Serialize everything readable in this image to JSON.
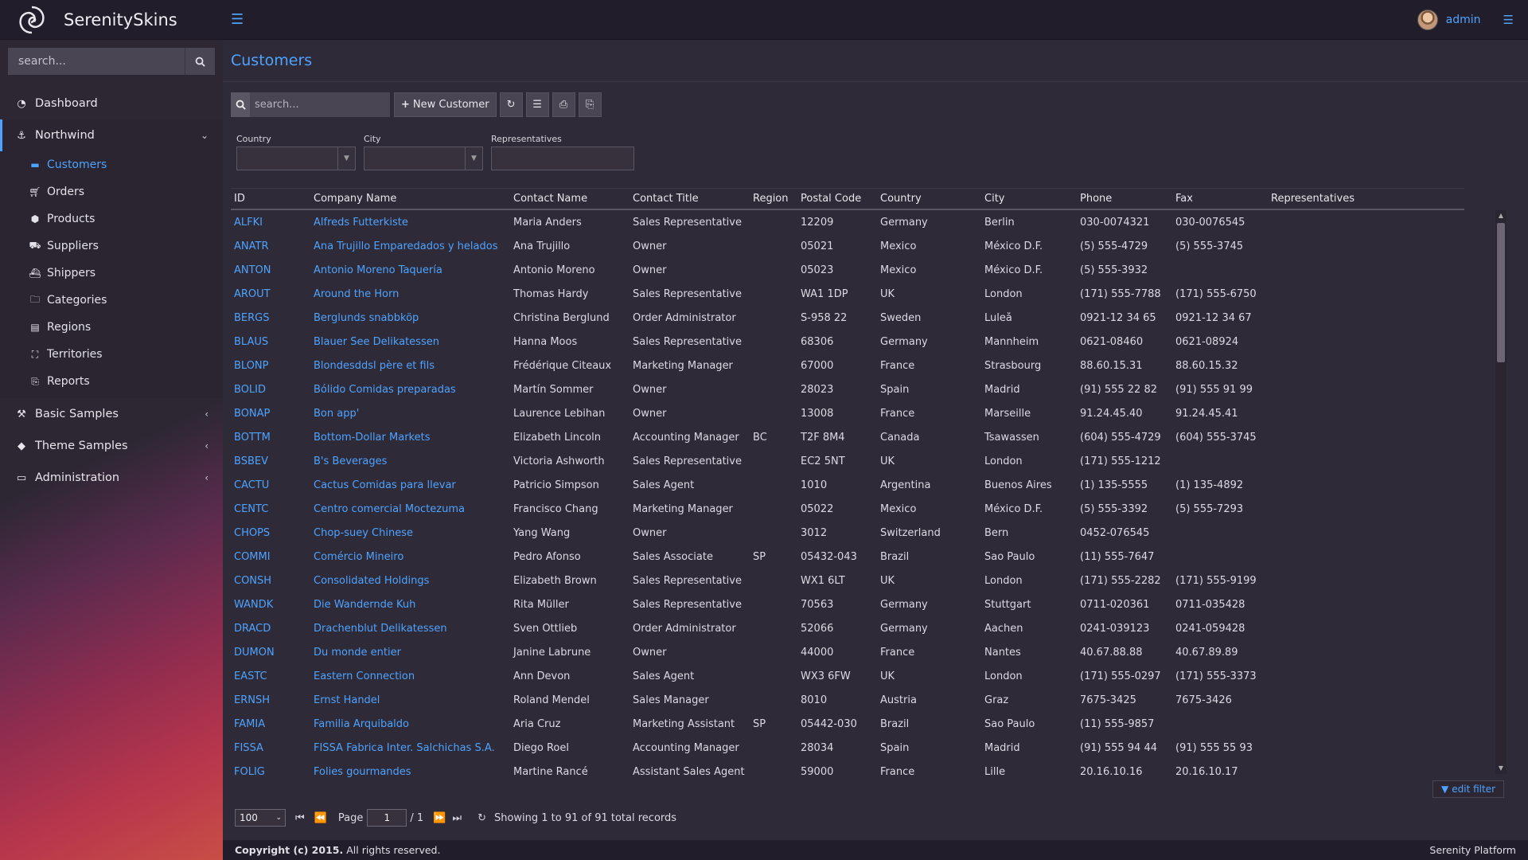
{
  "app": {
    "title": "SerenitySkins",
    "user": "admin"
  },
  "sidebar": {
    "search_placeholder": "search...",
    "dashboard": "Dashboard",
    "northwind": "Northwind",
    "northwind_items": [
      {
        "label": "Customers"
      },
      {
        "label": "Orders"
      },
      {
        "label": "Products"
      },
      {
        "label": "Suppliers"
      },
      {
        "label": "Shippers"
      },
      {
        "label": "Categories"
      },
      {
        "label": "Regions"
      },
      {
        "label": "Territories"
      },
      {
        "label": "Reports"
      }
    ],
    "basic_samples": "Basic Samples",
    "theme_samples": "Theme Samples",
    "administration": "Administration"
  },
  "page": {
    "title": "Customers"
  },
  "toolbar": {
    "search_placeholder": "search...",
    "new_customer": "New Customer"
  },
  "filters": {
    "country": "Country",
    "city": "City",
    "representatives": "Representatives"
  },
  "columns": [
    "ID",
    "Company Name",
    "Contact Name",
    "Contact Title",
    "Region",
    "Postal Code",
    "Country",
    "City",
    "Phone",
    "Fax",
    "Representatives"
  ],
  "rows": [
    [
      "ALFKI",
      "Alfreds Futterkiste",
      "Maria Anders",
      "Sales Representative",
      "",
      "12209",
      "Germany",
      "Berlin",
      "030-0074321",
      "030-0076545",
      ""
    ],
    [
      "ANATR",
      "Ana Trujillo Emparedados y helados",
      "Ana Trujillo",
      "Owner",
      "",
      "05021",
      "Mexico",
      "México D.F.",
      "(5) 555-4729",
      "(5) 555-3745",
      ""
    ],
    [
      "ANTON",
      "Antonio Moreno Taquería",
      "Antonio Moreno",
      "Owner",
      "",
      "05023",
      "Mexico",
      "México D.F.",
      "(5) 555-3932",
      "",
      ""
    ],
    [
      "AROUT",
      "Around the Horn",
      "Thomas Hardy",
      "Sales Representative",
      "",
      "WA1 1DP",
      "UK",
      "London",
      "(171) 555-7788",
      "(171) 555-6750",
      ""
    ],
    [
      "BERGS",
      "Berglunds snabbköp",
      "Christina Berglund",
      "Order Administrator",
      "",
      "S-958 22",
      "Sweden",
      "Luleå",
      "0921-12 34 65",
      "0921-12 34 67",
      ""
    ],
    [
      "BLAUS",
      "Blauer See Delikatessen",
      "Hanna Moos",
      "Sales Representative",
      "",
      "68306",
      "Germany",
      "Mannheim",
      "0621-08460",
      "0621-08924",
      ""
    ],
    [
      "BLONP",
      "Blondesddsl père et fils",
      "Frédérique Citeaux",
      "Marketing Manager",
      "",
      "67000",
      "France",
      "Strasbourg",
      "88.60.15.31",
      "88.60.15.32",
      ""
    ],
    [
      "BOLID",
      "Bólido Comidas preparadas",
      "Martín Sommer",
      "Owner",
      "",
      "28023",
      "Spain",
      "Madrid",
      "(91) 555 22 82",
      "(91) 555 91 99",
      ""
    ],
    [
      "BONAP",
      "Bon app'",
      "Laurence Lebihan",
      "Owner",
      "",
      "13008",
      "France",
      "Marseille",
      "91.24.45.40",
      "91.24.45.41",
      ""
    ],
    [
      "BOTTM",
      "Bottom-Dollar Markets",
      "Elizabeth Lincoln",
      "Accounting Manager",
      "BC",
      "T2F 8M4",
      "Canada",
      "Tsawassen",
      "(604) 555-4729",
      "(604) 555-3745",
      ""
    ],
    [
      "BSBEV",
      "B's Beverages",
      "Victoria Ashworth",
      "Sales Representative",
      "",
      "EC2 5NT",
      "UK",
      "London",
      "(171) 555-1212",
      "",
      ""
    ],
    [
      "CACTU",
      "Cactus Comidas para llevar",
      "Patricio Simpson",
      "Sales Agent",
      "",
      "1010",
      "Argentina",
      "Buenos Aires",
      "(1) 135-5555",
      "(1) 135-4892",
      ""
    ],
    [
      "CENTC",
      "Centro comercial Moctezuma",
      "Francisco Chang",
      "Marketing Manager",
      "",
      "05022",
      "Mexico",
      "México D.F.",
      "(5) 555-3392",
      "(5) 555-7293",
      ""
    ],
    [
      "CHOPS",
      "Chop-suey Chinese",
      "Yang Wang",
      "Owner",
      "",
      "3012",
      "Switzerland",
      "Bern",
      "0452-076545",
      "",
      ""
    ],
    [
      "COMMI",
      "Comércio Mineiro",
      "Pedro Afonso",
      "Sales Associate",
      "SP",
      "05432-043",
      "Brazil",
      "Sao Paulo",
      "(11) 555-7647",
      "",
      ""
    ],
    [
      "CONSH",
      "Consolidated Holdings",
      "Elizabeth Brown",
      "Sales Representative",
      "",
      "WX1 6LT",
      "UK",
      "London",
      "(171) 555-2282",
      "(171) 555-9199",
      ""
    ],
    [
      "WANDK",
      "Die Wandernde Kuh",
      "Rita Müller",
      "Sales Representative",
      "",
      "70563",
      "Germany",
      "Stuttgart",
      "0711-020361",
      "0711-035428",
      ""
    ],
    [
      "DRACD",
      "Drachenblut Delikatessen",
      "Sven Ottlieb",
      "Order Administrator",
      "",
      "52066",
      "Germany",
      "Aachen",
      "0241-039123",
      "0241-059428",
      ""
    ],
    [
      "DUMON",
      "Du monde entier",
      "Janine Labrune",
      "Owner",
      "",
      "44000",
      "France",
      "Nantes",
      "40.67.88.88",
      "40.67.89.89",
      ""
    ],
    [
      "EASTC",
      "Eastern Connection",
      "Ann Devon",
      "Sales Agent",
      "",
      "WX3 6FW",
      "UK",
      "London",
      "(171) 555-0297",
      "(171) 555-3373",
      ""
    ],
    [
      "ERNSH",
      "Ernst Handel",
      "Roland Mendel",
      "Sales Manager",
      "",
      "8010",
      "Austria",
      "Graz",
      "7675-3425",
      "7675-3426",
      ""
    ],
    [
      "FAMIA",
      "Familia Arquibaldo",
      "Aria Cruz",
      "Marketing Assistant",
      "SP",
      "05442-030",
      "Brazil",
      "Sao Paulo",
      "(11) 555-9857",
      "",
      ""
    ],
    [
      "FISSA",
      "FISSA Fabrica Inter. Salchichas S.A.",
      "Diego Roel",
      "Accounting Manager",
      "",
      "28034",
      "Spain",
      "Madrid",
      "(91) 555 94 44",
      "(91) 555 55 93",
      ""
    ],
    [
      "FOLIG",
      "Folies gourmandes",
      "Martine Rancé",
      "Assistant Sales Agent",
      "",
      "59000",
      "France",
      "Lille",
      "20.16.10.16",
      "20.16.10.17",
      ""
    ]
  ],
  "edit_filter": "edit filter",
  "pager": {
    "page_size": "100",
    "page_label": "Page",
    "page": "1",
    "of": "/ 1",
    "status": "Showing 1 to 91 of 91 total records"
  },
  "footer": {
    "copyright": "Copyright (c) 2015.",
    "rights": "All rights reserved.",
    "platform": "Serenity Platform"
  },
  "colors": {
    "accent": "#4da3ff",
    "topbar": "#221d2b",
    "content": "#2f2a37"
  }
}
